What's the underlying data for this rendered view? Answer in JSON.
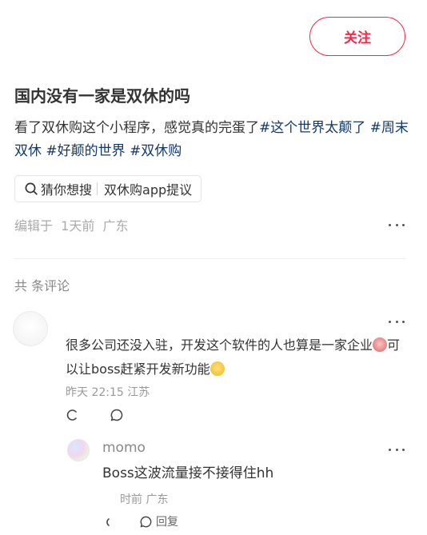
{
  "header": {
    "follow_label": "关注"
  },
  "post": {
    "title": "国内没有一家是双休的吗",
    "body_text": "看了双休购这个小程序，感觉真的完蛋了",
    "tags": [
      "#这个世界太颠了",
      "#周末双休",
      "#好颠的世界",
      "#双休购"
    ],
    "search_chip": {
      "prefix": "猜你想搜",
      "query": "双休购app提议"
    },
    "meta": "编辑于  1天前  广东"
  },
  "comments_header": {
    "label": "共 条评论"
  },
  "comments": [
    {
      "text_part1": "很多公司还没入驻，开发这个软件的人也算是一家企业",
      "text_part2": "可以让boss赶紧开发新功能",
      "meta": "昨天 22:15 江苏",
      "reply": {
        "username": "momo",
        "text": "Boss这波流量接不接得住hh",
        "meta": "时前 广东",
        "reply_label": "回复"
      }
    }
  ],
  "colors": {
    "accent": "#ff2442",
    "tag": "#13386c",
    "meta": "#aaaaaa"
  }
}
